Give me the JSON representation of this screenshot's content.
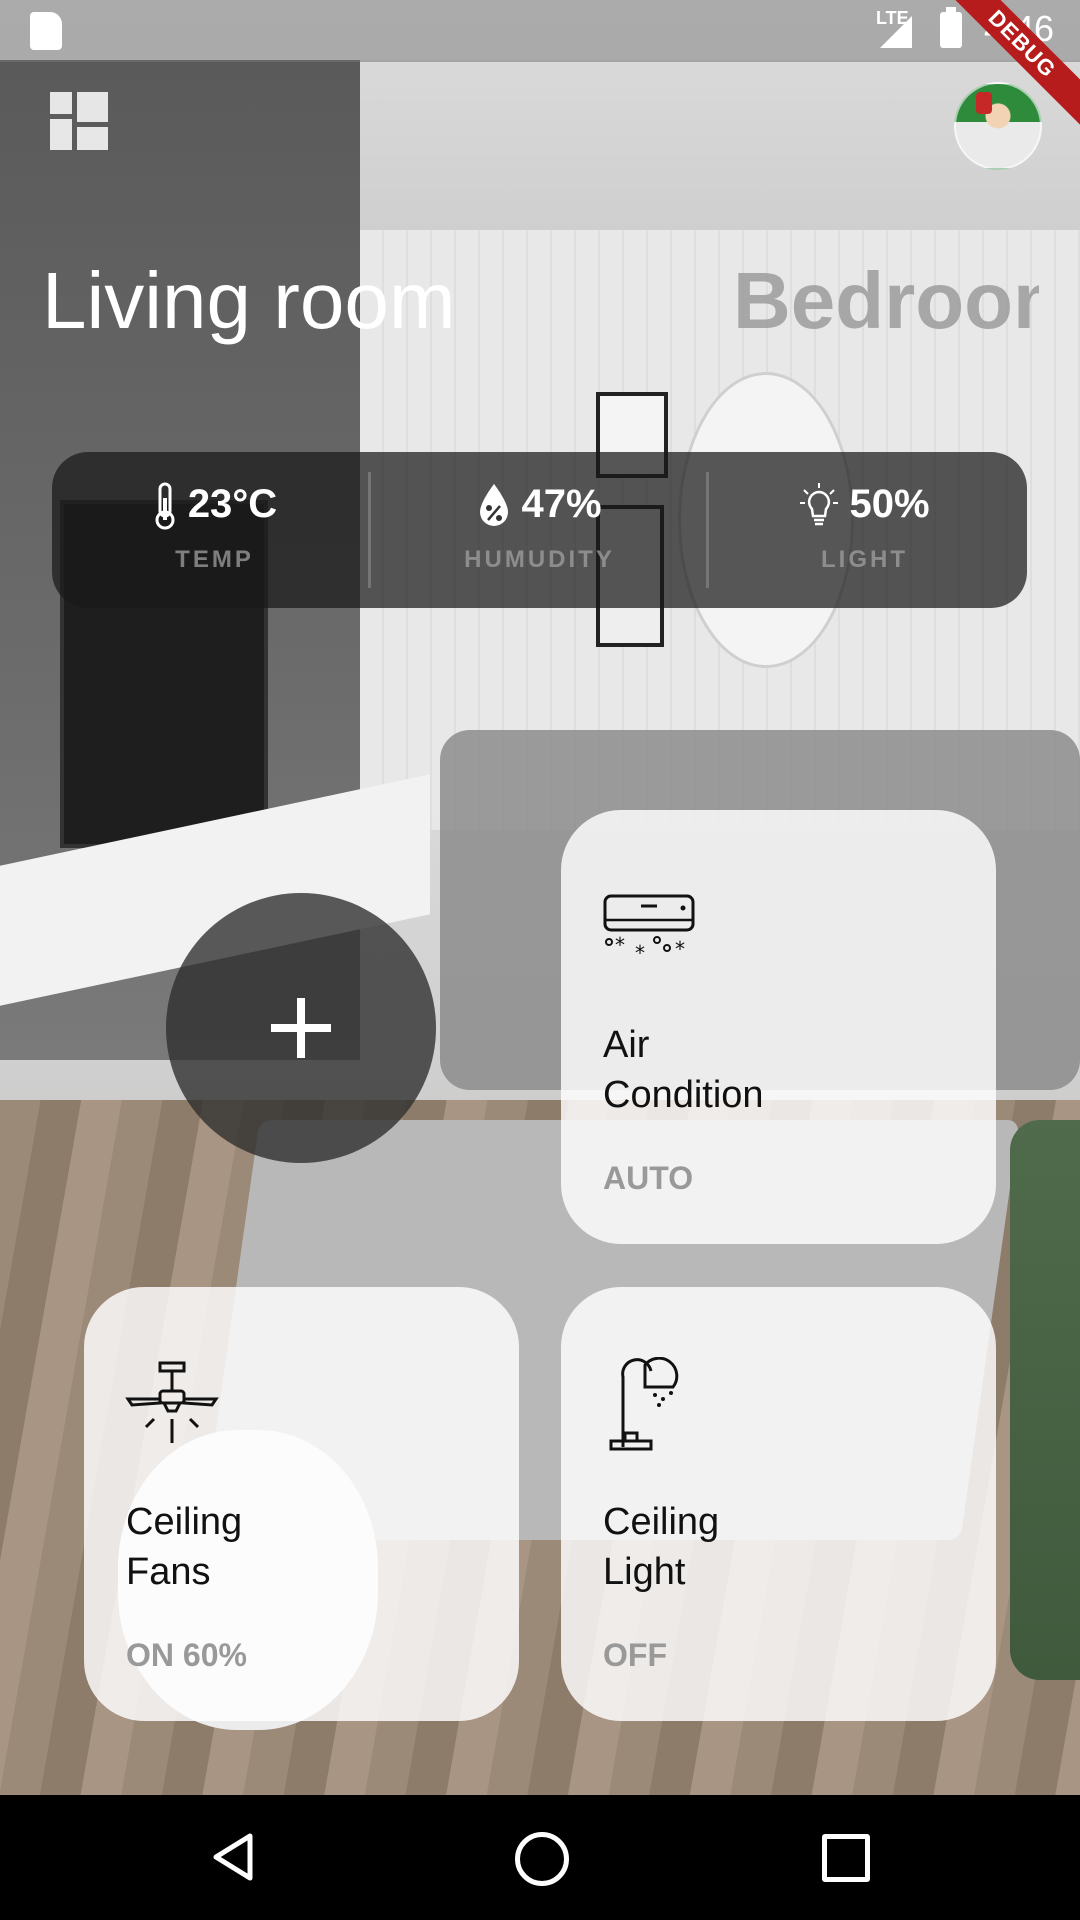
{
  "status_bar": {
    "network": "LTE",
    "time": "4:46",
    "debug_banner": "DEBUG"
  },
  "header": {
    "menu_icon": "dashboard-icon",
    "avatar": "user-avatar"
  },
  "rooms": {
    "current": "Living room",
    "next": "Bedroom"
  },
  "stats": [
    {
      "icon": "thermometer-icon",
      "value": "23°C",
      "label": "TEMP"
    },
    {
      "icon": "humidity-drop-icon",
      "value": "47%",
      "label": "HUMUDITY"
    },
    {
      "icon": "lightbulb-icon",
      "value": "50%",
      "label": "LIGHT"
    }
  ],
  "devices": [
    {
      "icon": "air-conditioner-icon",
      "name_line1": "Air",
      "name_line2": "Condition",
      "status": "AUTO"
    },
    {
      "icon": "ceiling-fan-icon",
      "name_line1": "Ceiling",
      "name_line2": "Fans",
      "status": "ON 60%"
    },
    {
      "icon": "lamp-icon",
      "name_line1": "Ceiling",
      "name_line2": "Light",
      "status": "OFF"
    }
  ],
  "add_button": {
    "icon": "plus-icon"
  },
  "colors": {
    "stats_panel": "#191919",
    "card": "#ffffff",
    "debug_ribbon": "#b71c1c",
    "muted_text": "#999999"
  }
}
